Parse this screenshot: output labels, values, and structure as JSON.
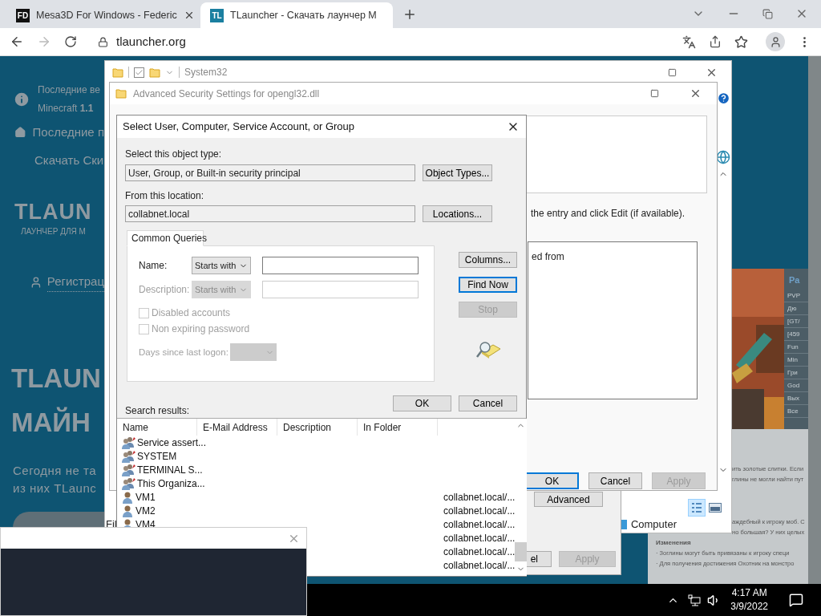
{
  "browser": {
    "tabs": [
      {
        "favicon": "FD",
        "title": "Mesa3D For Windows - Federic",
        "selected": false
      },
      {
        "favicon": "TL",
        "title": "TLauncher - Скачать лаунчер M",
        "selected": true
      }
    ],
    "address": "tlauncher.org"
  },
  "website": {
    "notice_lines": [
      "Последние ве",
      "Minecraft **1.1**"
    ],
    "nav": [
      "Последние п",
      "Скачать Ски"
    ],
    "logo": "TLAUN",
    "tagline": "ЛАУНЧЕР ДЛЯ М",
    "register": "Регистрац",
    "headline": [
      "TLAUN",
      "МАЙН"
    ],
    "intro": [
      "Сегодня не та",
      "из них TLaunc"
    ],
    "server_list": {
      "title": "Ра",
      "items": [
        "PVP",
        "Дю",
        "[GT/",
        "[459",
        "Fun",
        "Min",
        "Гри",
        "God",
        "Вых",
        "Все"
      ]
    },
    "article_lines": [
      "ить золотые слитки. Если",
      "глины не могли найти пут",
      "аждебный к игроку моб. С",
      "но большая? У них целых"
    ],
    "changes_title": "Изменения",
    "changes": [
      "· Зоглины могут быть привязаны к игроку специ",
      "· Для получения достижения Охотник на монстро"
    ]
  },
  "explorer": {
    "title": "System32",
    "file_menu": "Fil",
    "status": "Computer",
    "view_details_selected": true
  },
  "properties": {
    "advanced_button": "Advanced",
    "cancel_button": "el",
    "apply_button": {
      "label": "Apply",
      "disabled": true
    }
  },
  "advanced_security": {
    "title": "Advanced Security Settings for opengl32.dll",
    "instruction": "the entry and click Edit (if available).",
    "box_text": "ed from",
    "buttons": [
      {
        "label": "OK",
        "focused": true,
        "disabled": false
      },
      {
        "label": "Cancel",
        "focused": false,
        "disabled": false
      },
      {
        "label": "Apply",
        "focused": false,
        "disabled": true
      }
    ]
  },
  "select_dialog": {
    "title": "Select User, Computer, Service Account, or Group",
    "object_type_label": "Select this object type:",
    "object_type": "User, Group, or Built-in security principal",
    "object_types_button": "Object Types...",
    "location_label": "From this location:",
    "location": "collabnet.local",
    "locations_button": "Locations...",
    "query_tab": {
      "label": "Common Queries",
      "selected": true
    },
    "query_fields": [
      {
        "label": "Name:",
        "mode": "Starts with",
        "disabled": false
      },
      {
        "label": "Description:",
        "mode": "Starts with",
        "disabled": true
      }
    ],
    "checkboxes": [
      {
        "label": "Disabled accounts",
        "checked": false,
        "disabled": true
      },
      {
        "label": "Non expiring password",
        "checked": false,
        "disabled": true
      }
    ],
    "days_label": "Days since last logon:",
    "days_disabled": true,
    "side_buttons": [
      {
        "label": "Columns...",
        "focused": false,
        "disabled": false
      },
      {
        "label": "Find Now",
        "focused": true,
        "disabled": false
      },
      {
        "label": "Stop",
        "focused": false,
        "disabled": true
      }
    ],
    "ok_button": "OK",
    "cancel_button": "Cancel",
    "results_label": "Search results:",
    "columns": [
      "Name",
      "E-Mail Address",
      "Description",
      "In Folder"
    ],
    "rows": [
      {
        "kind": "group",
        "name": "Service assert..."
      },
      {
        "kind": "group",
        "name": "SYSTEM"
      },
      {
        "kind": "group",
        "name": "TERMINAL S..."
      },
      {
        "kind": "group",
        "name": "This Organiza..."
      },
      {
        "kind": "user",
        "name": "VM1",
        "folder": "collabnet.local/..."
      },
      {
        "kind": "user",
        "name": "VM2",
        "folder": "collabnet.local/..."
      },
      {
        "kind": "user",
        "name": "VM4",
        "folder": "collabnet.local/..."
      },
      {
        "folder": "collabnet.local/..."
      },
      {
        "folder": "collabnet.local/..."
      },
      {
        "folder": "collabnet.local/..."
      }
    ]
  },
  "taskbar": {
    "time": "4:17 AM",
    "date": "3/9/2022"
  }
}
